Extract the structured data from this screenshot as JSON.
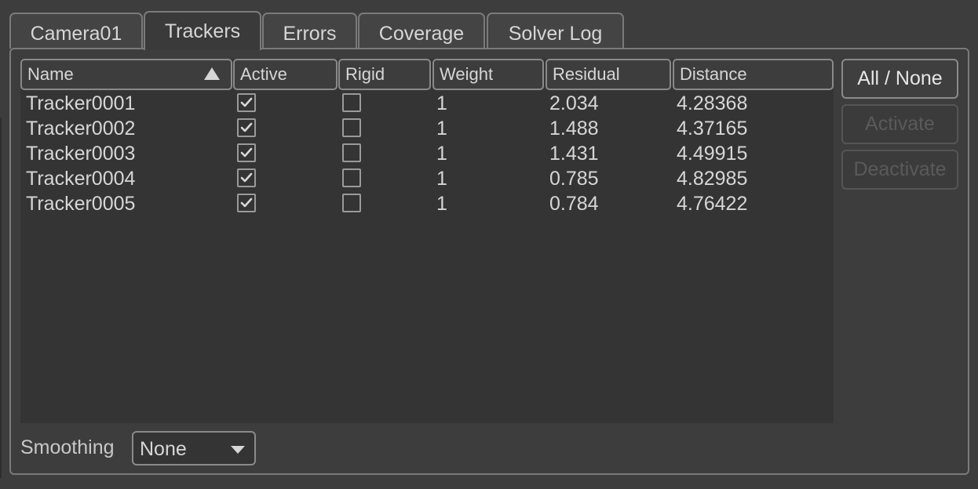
{
  "tabs": [
    {
      "label": "Camera01",
      "active": false
    },
    {
      "label": "Trackers",
      "active": true
    },
    {
      "label": "Errors",
      "active": false
    },
    {
      "label": "Coverage",
      "active": false
    },
    {
      "label": "Solver Log",
      "active": false
    }
  ],
  "table": {
    "columns": [
      "Name",
      "Active",
      "Rigid",
      "Weight",
      "Residual",
      "Distance"
    ],
    "sort_column": "Name",
    "sort_direction": "ascending",
    "rows": [
      {
        "name": "Tracker0001",
        "active": true,
        "rigid": false,
        "weight": "1",
        "residual": "2.034",
        "distance": "4.28368"
      },
      {
        "name": "Tracker0002",
        "active": true,
        "rigid": false,
        "weight": "1",
        "residual": "1.488",
        "distance": "4.37165"
      },
      {
        "name": "Tracker0003",
        "active": true,
        "rigid": false,
        "weight": "1",
        "residual": "1.431",
        "distance": "4.49915"
      },
      {
        "name": "Tracker0004",
        "active": true,
        "rigid": false,
        "weight": "1",
        "residual": "0.785",
        "distance": "4.82985"
      },
      {
        "name": "Tracker0005",
        "active": true,
        "rigid": false,
        "weight": "1",
        "residual": "0.784",
        "distance": "4.76422"
      }
    ]
  },
  "buttons": {
    "all_none": "All / None",
    "activate": "Activate",
    "deactivate": "Deactivate"
  },
  "smoothing": {
    "label": "Smoothing",
    "value": "None"
  },
  "colors": {
    "background": "#3d3d3d",
    "table_background": "#343434",
    "border": "#8a8a8a",
    "text": "#d6d6d6",
    "disabled_text": "#5a5a5a"
  },
  "icons": {
    "sort": "sort-ascending-icon",
    "check": "checkmark-icon",
    "dropdown": "chevron-down-icon"
  }
}
